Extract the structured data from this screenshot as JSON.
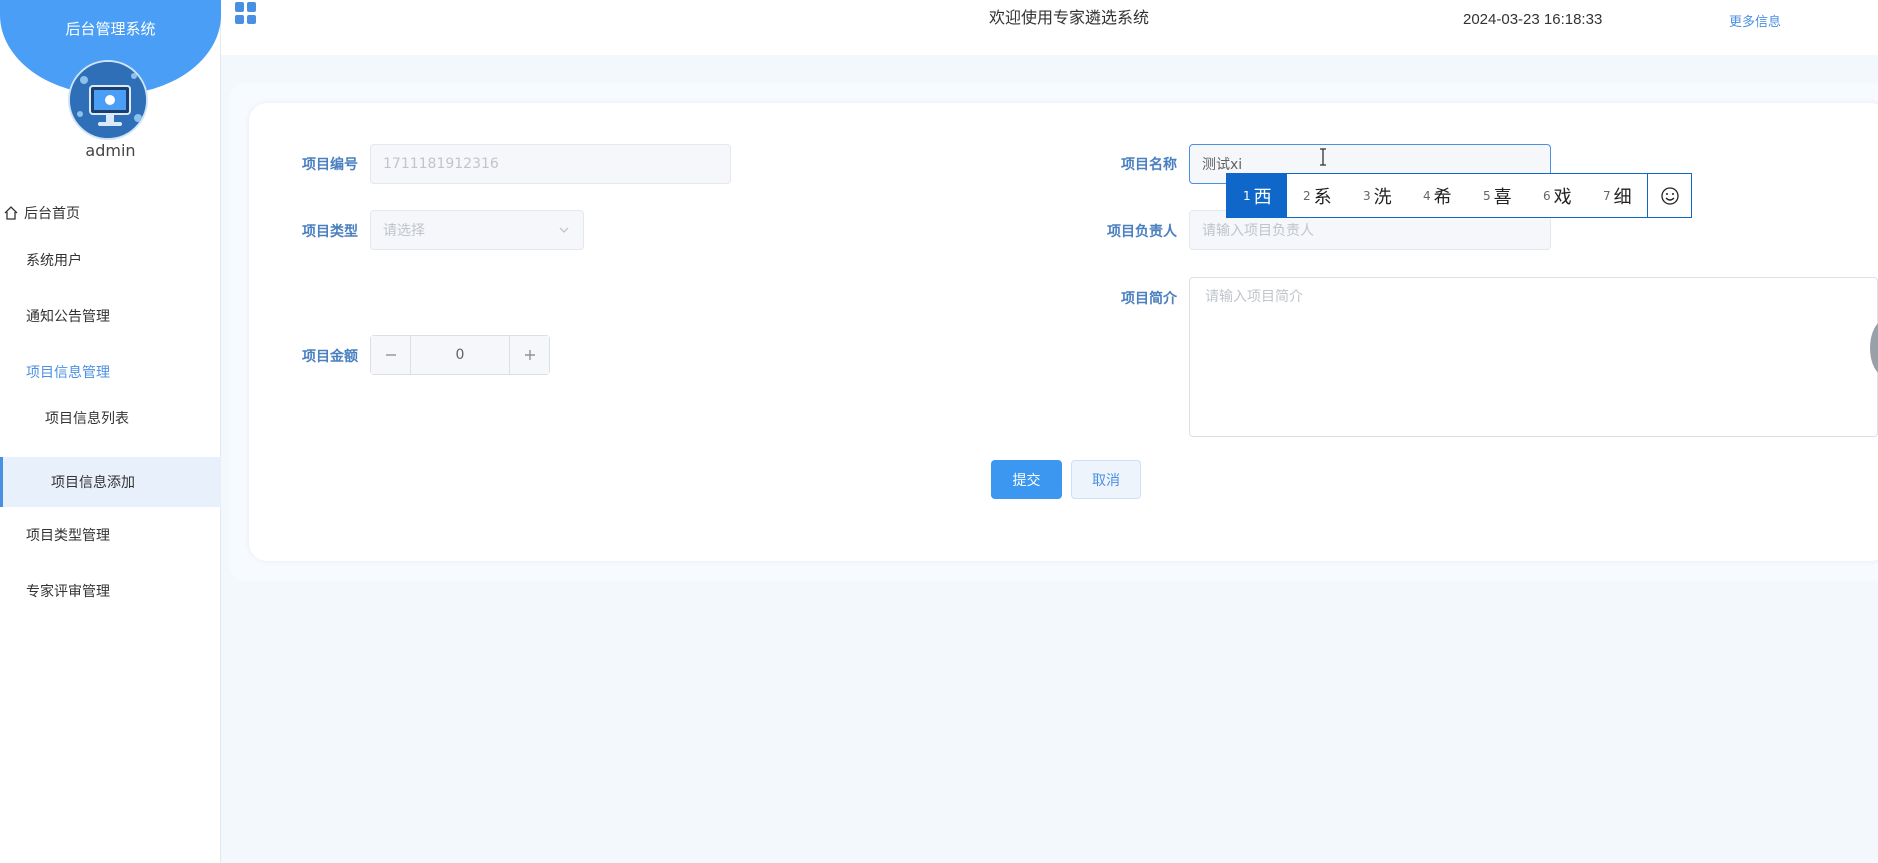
{
  "sidebar": {
    "title": "后台管理系统",
    "username": "admin",
    "items": [
      {
        "label": "后台首页"
      },
      {
        "label": "系统用户"
      },
      {
        "label": "通知公告管理"
      },
      {
        "label": "项目信息管理"
      },
      {
        "label": "项目信息列表"
      },
      {
        "label": "项目信息添加"
      },
      {
        "label": "项目类型管理"
      },
      {
        "label": "专家评审管理"
      }
    ]
  },
  "header": {
    "title": "欢迎使用专家遴选系统",
    "datetime": "2024-03-23 16:18:33",
    "more": "更多信息"
  },
  "form": {
    "project_no": {
      "label": "项目编号",
      "value": "1711181912316"
    },
    "project_type": {
      "label": "项目类型",
      "placeholder": "请选择"
    },
    "project_amount": {
      "label": "项目金额",
      "value": "0"
    },
    "project_name": {
      "label": "项目名称",
      "value": "测试xi"
    },
    "project_owner": {
      "label": "项目负责人",
      "placeholder": "请输入项目负责人"
    },
    "project_intro": {
      "label": "项目简介",
      "placeholder": "请输入项目简介"
    },
    "submit": "提交",
    "cancel": "取消"
  },
  "ime": {
    "candidates": [
      {
        "num": "1",
        "char": "西"
      },
      {
        "num": "2",
        "char": "系"
      },
      {
        "num": "3",
        "char": "洗"
      },
      {
        "num": "4",
        "char": "希"
      },
      {
        "num": "5",
        "char": "喜"
      },
      {
        "num": "6",
        "char": "戏"
      },
      {
        "num": "7",
        "char": "细"
      }
    ]
  },
  "colors": {
    "accent": "#4a90e2",
    "sidebar_blob": "#4a9ef5",
    "ime_highlight": "#0f67c9",
    "submit": "#3b97f0"
  }
}
